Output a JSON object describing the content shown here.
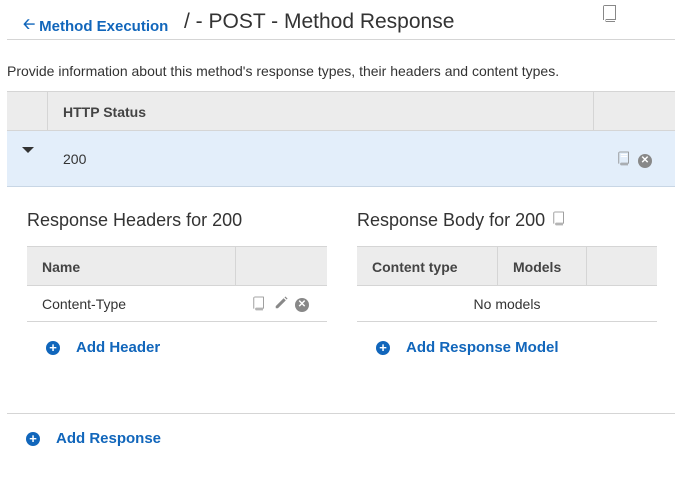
{
  "header": {
    "back_label": "Method Execution",
    "title": "/ - POST - Method Response"
  },
  "description": "Provide information about this method's response types, their headers and content types.",
  "status_table": {
    "column_header": "HTTP Status",
    "rows": [
      {
        "code": "200"
      }
    ]
  },
  "response_headers": {
    "title": "Response Headers for 200",
    "column_name": "Name",
    "rows": [
      {
        "name": "Content-Type"
      }
    ],
    "add_label": "Add Header"
  },
  "response_body": {
    "title": "Response Body for 200",
    "column_content_type": "Content type",
    "column_models": "Models",
    "empty_text": "No models",
    "add_label": "Add Response Model"
  },
  "add_response_label": "Add Response",
  "colors": {
    "link": "#1166bb",
    "selected_row_bg": "#e3eefa",
    "table_header_bg": "#ececec",
    "icon_gray": "#888888"
  },
  "icons": [
    "arrow-left-icon",
    "book-icon",
    "pencil-icon",
    "close-circle-icon",
    "plus-circle-icon",
    "caret-down-icon"
  ]
}
